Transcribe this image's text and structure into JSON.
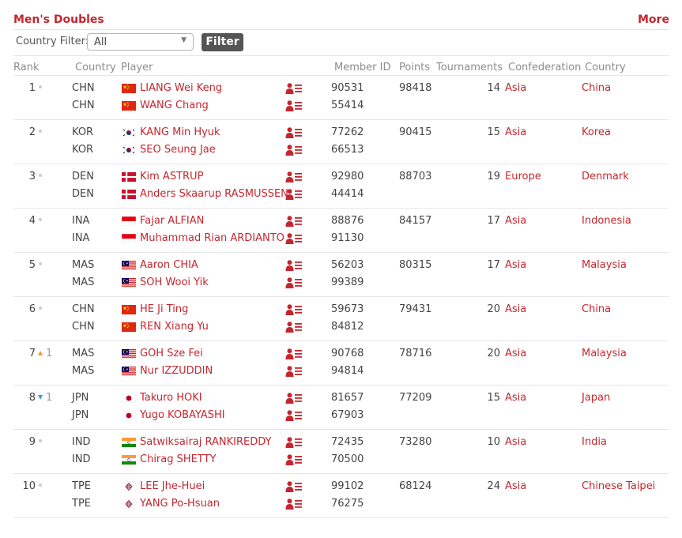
{
  "header": {
    "title": "Men's Doubles",
    "more": "More"
  },
  "filter": {
    "label": "Country Filter:",
    "selected": "All",
    "button": "Filter"
  },
  "columns": {
    "rank": "Rank",
    "country": "Country",
    "player": "Player",
    "member_id": "Member ID",
    "points": "Points",
    "tournaments": "Tournaments",
    "confederation": "Confederation",
    "country_name": "Country"
  },
  "colors": {
    "accent": "#c5262e",
    "rank_up": "#f0a030",
    "rank_down": "#3a9be0"
  },
  "icons": {
    "rank_same": "dot-icon",
    "rank_up": "triangle-up-icon",
    "rank_down": "triangle-down-icon",
    "profile": "player-profile-icon"
  },
  "rows": [
    {
      "rank": "1",
      "change": "none",
      "change_value": "",
      "points": "98418",
      "tournaments": "14",
      "confederation": "Asia",
      "country_name": "China",
      "players": [
        {
          "code": "CHN",
          "flag": "china",
          "name": "LIANG Wei Keng",
          "id": "90531"
        },
        {
          "code": "CHN",
          "flag": "china",
          "name": "WANG Chang",
          "id": "55414"
        }
      ]
    },
    {
      "rank": "2",
      "change": "none",
      "change_value": "",
      "points": "90415",
      "tournaments": "15",
      "confederation": "Asia",
      "country_name": "Korea",
      "players": [
        {
          "code": "KOR",
          "flag": "korea",
          "name": "KANG Min Hyuk",
          "id": "77262"
        },
        {
          "code": "KOR",
          "flag": "korea",
          "name": "SEO Seung Jae",
          "id": "66513"
        }
      ]
    },
    {
      "rank": "3",
      "change": "none",
      "change_value": "",
      "points": "88703",
      "tournaments": "19",
      "confederation": "Europe",
      "country_name": "Denmark",
      "players": [
        {
          "code": "DEN",
          "flag": "denmark",
          "name": "Kim ASTRUP",
          "id": "92980"
        },
        {
          "code": "DEN",
          "flag": "denmark",
          "name": "Anders Skaarup RASMUSSEN",
          "id": "44414"
        }
      ]
    },
    {
      "rank": "4",
      "change": "none",
      "change_value": "",
      "points": "84157",
      "tournaments": "17",
      "confederation": "Asia",
      "country_name": "Indonesia",
      "players": [
        {
          "code": "INA",
          "flag": "indonesia",
          "name": "Fajar ALFIAN",
          "id": "88876"
        },
        {
          "code": "INA",
          "flag": "indonesia",
          "name": "Muhammad Rian ARDIANTO",
          "id": "91130"
        }
      ]
    },
    {
      "rank": "5",
      "change": "none",
      "change_value": "",
      "points": "80315",
      "tournaments": "17",
      "confederation": "Asia",
      "country_name": "Malaysia",
      "players": [
        {
          "code": "MAS",
          "flag": "malaysia",
          "name": "Aaron CHIA",
          "id": "56203"
        },
        {
          "code": "MAS",
          "flag": "malaysia",
          "name": "SOH Wooi Yik",
          "id": "99389"
        }
      ]
    },
    {
      "rank": "6",
      "change": "none",
      "change_value": "",
      "points": "79431",
      "tournaments": "20",
      "confederation": "Asia",
      "country_name": "China",
      "players": [
        {
          "code": "CHN",
          "flag": "china",
          "name": "HE Ji Ting",
          "id": "59673"
        },
        {
          "code": "CHN",
          "flag": "china",
          "name": "REN Xiang Yu",
          "id": "84812"
        }
      ]
    },
    {
      "rank": "7",
      "change": "up",
      "change_value": "1",
      "points": "78716",
      "tournaments": "20",
      "confederation": "Asia",
      "country_name": "Malaysia",
      "players": [
        {
          "code": "MAS",
          "flag": "malaysia",
          "name": "GOH Sze Fei",
          "id": "90768"
        },
        {
          "code": "MAS",
          "flag": "malaysia",
          "name": "Nur IZZUDDIN",
          "id": "94814"
        }
      ]
    },
    {
      "rank": "8",
      "change": "down",
      "change_value": "1",
      "points": "77209",
      "tournaments": "15",
      "confederation": "Asia",
      "country_name": "Japan",
      "players": [
        {
          "code": "JPN",
          "flag": "japan",
          "name": "Takuro HOKI",
          "id": "81657"
        },
        {
          "code": "JPN",
          "flag": "japan",
          "name": "Yugo KOBAYASHI",
          "id": "67903"
        }
      ]
    },
    {
      "rank": "9",
      "change": "none",
      "change_value": "",
      "points": "73280",
      "tournaments": "10",
      "confederation": "Asia",
      "country_name": "India",
      "players": [
        {
          "code": "IND",
          "flag": "india",
          "name": "Satwiksairaj RANKIREDDY",
          "id": "72435"
        },
        {
          "code": "IND",
          "flag": "india",
          "name": "Chirag SHETTY",
          "id": "70500"
        }
      ]
    },
    {
      "rank": "10",
      "change": "none",
      "change_value": "",
      "points": "68124",
      "tournaments": "24",
      "confederation": "Asia",
      "country_name": "Chinese Taipei",
      "players": [
        {
          "code": "TPE",
          "flag": "chinese-taipei",
          "name": "LEE Jhe-Huei",
          "id": "99102"
        },
        {
          "code": "TPE",
          "flag": "chinese-taipei",
          "name": "YANG Po-Hsuan",
          "id": "76275"
        }
      ]
    }
  ]
}
